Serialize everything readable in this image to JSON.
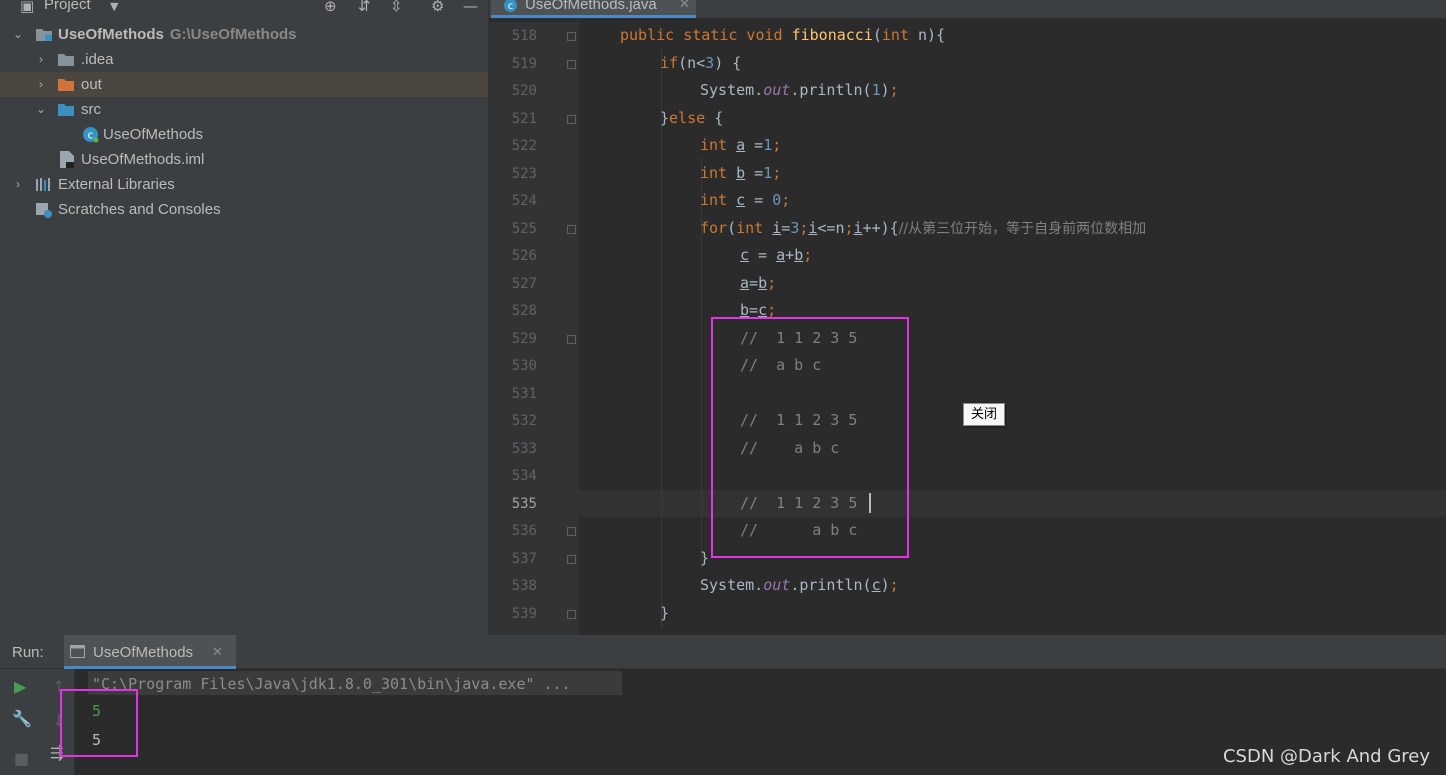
{
  "project_panel": {
    "title": "Project",
    "tree": [
      {
        "label": "UseOfMethods",
        "path": "G:\\UseOfMethods",
        "depth": 0,
        "expanded": true,
        "icon": "project-folder-icon"
      },
      {
        "label": ".idea",
        "depth": 1,
        "expanded": false,
        "icon": "folder-icon"
      },
      {
        "label": "out",
        "depth": 1,
        "expanded": false,
        "icon": "excluded-folder-icon",
        "selected": true
      },
      {
        "label": "src",
        "depth": 1,
        "expanded": true,
        "icon": "source-folder-icon"
      },
      {
        "label": "UseOfMethods",
        "depth": 2,
        "icon": "java-class-icon"
      },
      {
        "label": "UseOfMethods.iml",
        "depth": 1,
        "icon": "iml-file-icon"
      },
      {
        "label": "External Libraries",
        "depth": 0,
        "expanded": false,
        "icon": "libraries-icon"
      },
      {
        "label": "Scratches and Consoles",
        "depth": 0,
        "icon": "scratches-icon"
      }
    ]
  },
  "editor": {
    "tab_label": "UseOfMethods.java",
    "line_numbers": [
      "518",
      "519",
      "520",
      "521",
      "522",
      "523",
      "524",
      "525",
      "526",
      "527",
      "528",
      "529",
      "530",
      "531",
      "532",
      "533",
      "534",
      "535",
      "536",
      "537",
      "538",
      "539"
    ],
    "current_line": "535",
    "code": [
      "public static void fibonacci(int n){",
      "if(n<3) {",
      "System.out.println(1);",
      "}else {",
      "int a =1;",
      "int b =1;",
      "int c = 0;",
      "for(int i=3;i<=n;i++){//从第三位开始，等于自身前两位数相加",
      "c = a+b;",
      "a=b;",
      "b=c;",
      "//  1 1 2 3 5",
      "//  a b c",
      "",
      "//  1 1 2 3 5",
      "//    a b c",
      "",
      "//  1 1 2 3 5",
      "//      a b c",
      "}",
      "System.out.println(c);",
      "}"
    ],
    "tooltip": "关闭"
  },
  "run_panel": {
    "label": "Run:",
    "tab_label": "UseOfMethods",
    "console": [
      "\"C:\\Program Files\\Java\\jdk1.8.0_301\\bin\\java.exe\" ...",
      "5",
      "5"
    ]
  },
  "watermark": "CSDN @Dark And Grey",
  "colors": {
    "keyword": "#cc7832",
    "function": "#ffc66d",
    "number": "#6897bb",
    "static_field": "#9876aa",
    "comment": "#808080",
    "highlight": "#e234e2",
    "console_green": "#499c54"
  }
}
